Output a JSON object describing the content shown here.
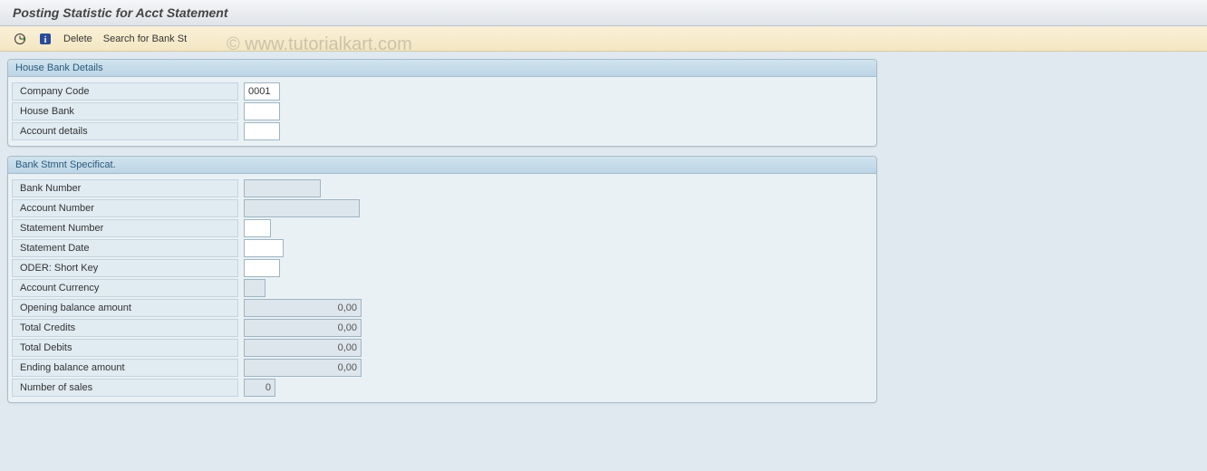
{
  "title": "Posting Statistic for Acct Statement",
  "toolbar": {
    "delete": "Delete",
    "search": "Search for Bank St"
  },
  "watermark": "© www.tutorialkart.com",
  "group1": {
    "title": "House Bank Details",
    "company_code_label": "Company Code",
    "company_code_value": "0001",
    "house_bank_label": "House Bank",
    "house_bank_value": "",
    "account_details_label": "Account details",
    "account_details_value": ""
  },
  "group2": {
    "title": "Bank Stmnt Specificat.",
    "bank_number_label": "Bank Number",
    "bank_number_value": "",
    "account_number_label": "Account Number",
    "account_number_value": "",
    "statement_number_label": "Statement Number",
    "statement_number_value": "",
    "statement_date_label": "Statement Date",
    "statement_date_value": "",
    "oder_short_key_label": "ODER: Short Key",
    "oder_short_key_value": "",
    "account_currency_label": "Account Currency",
    "account_currency_value": "",
    "opening_balance_label": "Opening balance amount",
    "opening_balance_value": "0,00",
    "total_credits_label": "Total Credits",
    "total_credits_value": "0,00",
    "total_debits_label": "Total Debits",
    "total_debits_value": "0,00",
    "ending_balance_label": "Ending balance amount",
    "ending_balance_value": "0,00",
    "number_sales_label": "Number of sales",
    "number_sales_value": "0"
  }
}
